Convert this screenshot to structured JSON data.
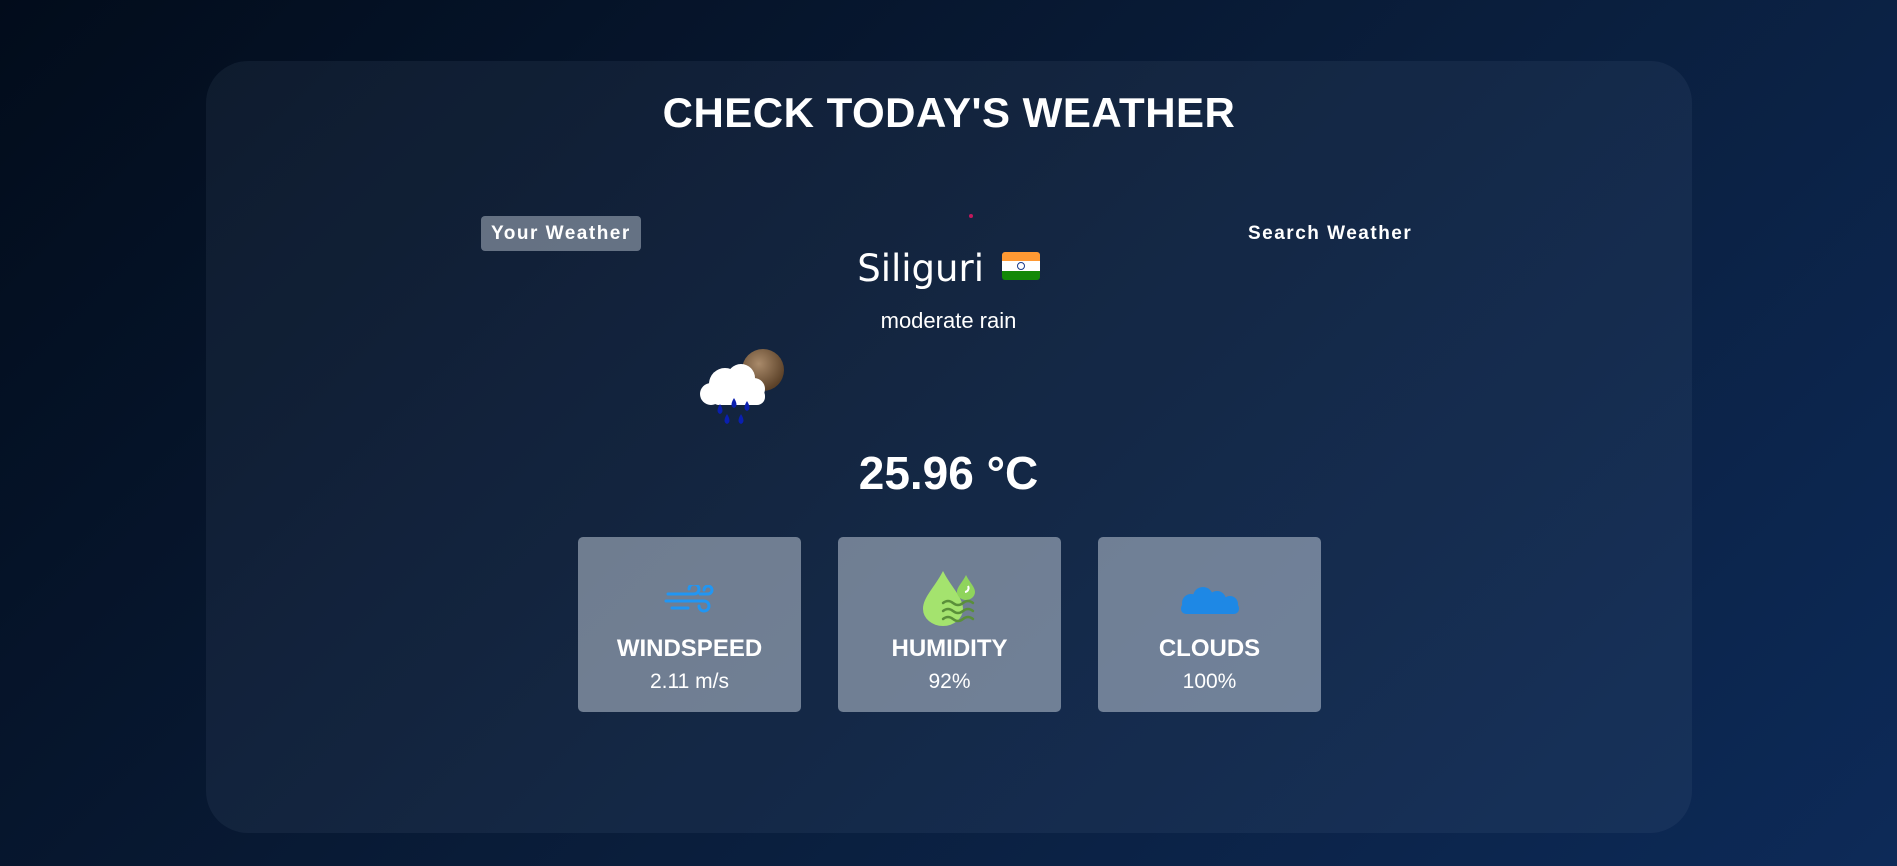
{
  "heading": "CHECK TODAY'S WEATHER",
  "tabs": {
    "your_weather": "Your Weather",
    "search_weather": "Search Weather"
  },
  "location": {
    "city": "Siliguri",
    "country_flag_icon": "flag-india-icon"
  },
  "weather": {
    "description": "moderate rain",
    "icon": "rain-cloud-moon-icon",
    "temperature": "25.96 °C"
  },
  "stats": [
    {
      "icon": "wind-icon",
      "label": "WINDSPEED",
      "value": "2.11 m/s"
    },
    {
      "icon": "humidity-drop-icon",
      "label": "HUMIDITY",
      "value": "92%"
    },
    {
      "icon": "cloud-icon",
      "label": "CLOUDS",
      "value": "100%"
    }
  ],
  "colors": {
    "background_top": "#020c1b",
    "background_bottom": "#0d2a58",
    "wind_icon": "#2196f3",
    "humidity_icon": "#9be26b",
    "cloud_icon": "#1e88e5"
  }
}
